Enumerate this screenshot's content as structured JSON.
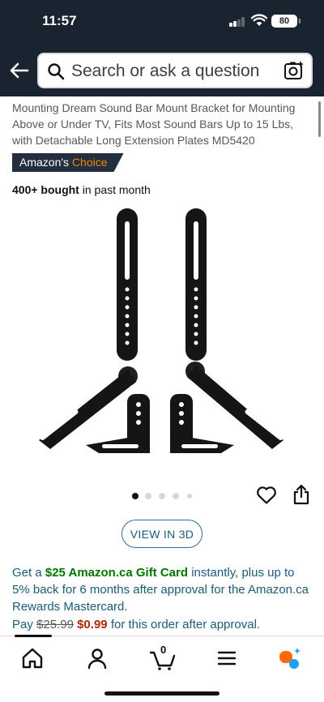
{
  "status_bar": {
    "time": "11:57",
    "battery": "80"
  },
  "search": {
    "placeholder": "Search or ask a question"
  },
  "product": {
    "title": "Mounting Dream Sound Bar Mount Bracket for Mounting Above or Under TV, Fits Most Sound Bars Up to 15 Lbs, with Detachable Long Extension Plates MD5420",
    "badge_prefix": "Amazon's",
    "badge_choice": "Choice",
    "bought_count": "400+ bought",
    "bought_suffix": "in past month",
    "image_dots": 5,
    "active_dot": 0
  },
  "view_3d_label": "VIEW IN 3D",
  "promo": {
    "prefix": "Get a",
    "gift_card": "$25 Amazon.ca Gift Card",
    "text": "instantly, plus up to 5% back for 6 months after approval for the Amazon.ca Rewards Mastercard.",
    "pay_prefix": "Pay",
    "old_price": "$25.99",
    "new_price": "$0.99",
    "pay_suffix": "for this order after approval."
  },
  "nav": {
    "cart_count": "0",
    "items": [
      "home-icon",
      "account-icon",
      "cart-icon",
      "menu-icon",
      "rufus-ai-icon"
    ]
  },
  "colors": {
    "header_bg": "#1a2330",
    "link": "#1a5c7a",
    "gift_green": "#007600",
    "price_red": "#b12704",
    "choice_orange": "#f08804"
  }
}
